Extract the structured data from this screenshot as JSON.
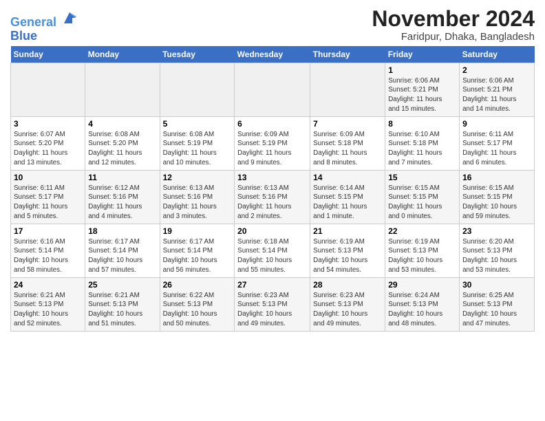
{
  "header": {
    "logo_line1": "General",
    "logo_line2": "Blue",
    "month": "November 2024",
    "location": "Faridpur, Dhaka, Bangladesh"
  },
  "weekdays": [
    "Sunday",
    "Monday",
    "Tuesday",
    "Wednesday",
    "Thursday",
    "Friday",
    "Saturday"
  ],
  "weeks": [
    [
      {
        "day": "",
        "info": ""
      },
      {
        "day": "",
        "info": ""
      },
      {
        "day": "",
        "info": ""
      },
      {
        "day": "",
        "info": ""
      },
      {
        "day": "",
        "info": ""
      },
      {
        "day": "1",
        "info": "Sunrise: 6:06 AM\nSunset: 5:21 PM\nDaylight: 11 hours\nand 15 minutes."
      },
      {
        "day": "2",
        "info": "Sunrise: 6:06 AM\nSunset: 5:21 PM\nDaylight: 11 hours\nand 14 minutes."
      }
    ],
    [
      {
        "day": "3",
        "info": "Sunrise: 6:07 AM\nSunset: 5:20 PM\nDaylight: 11 hours\nand 13 minutes."
      },
      {
        "day": "4",
        "info": "Sunrise: 6:08 AM\nSunset: 5:20 PM\nDaylight: 11 hours\nand 12 minutes."
      },
      {
        "day": "5",
        "info": "Sunrise: 6:08 AM\nSunset: 5:19 PM\nDaylight: 11 hours\nand 10 minutes."
      },
      {
        "day": "6",
        "info": "Sunrise: 6:09 AM\nSunset: 5:19 PM\nDaylight: 11 hours\nand 9 minutes."
      },
      {
        "day": "7",
        "info": "Sunrise: 6:09 AM\nSunset: 5:18 PM\nDaylight: 11 hours\nand 8 minutes."
      },
      {
        "day": "8",
        "info": "Sunrise: 6:10 AM\nSunset: 5:18 PM\nDaylight: 11 hours\nand 7 minutes."
      },
      {
        "day": "9",
        "info": "Sunrise: 6:11 AM\nSunset: 5:17 PM\nDaylight: 11 hours\nand 6 minutes."
      }
    ],
    [
      {
        "day": "10",
        "info": "Sunrise: 6:11 AM\nSunset: 5:17 PM\nDaylight: 11 hours\nand 5 minutes."
      },
      {
        "day": "11",
        "info": "Sunrise: 6:12 AM\nSunset: 5:16 PM\nDaylight: 11 hours\nand 4 minutes."
      },
      {
        "day": "12",
        "info": "Sunrise: 6:13 AM\nSunset: 5:16 PM\nDaylight: 11 hours\nand 3 minutes."
      },
      {
        "day": "13",
        "info": "Sunrise: 6:13 AM\nSunset: 5:16 PM\nDaylight: 11 hours\nand 2 minutes."
      },
      {
        "day": "14",
        "info": "Sunrise: 6:14 AM\nSunset: 5:15 PM\nDaylight: 11 hours\nand 1 minute."
      },
      {
        "day": "15",
        "info": "Sunrise: 6:15 AM\nSunset: 5:15 PM\nDaylight: 11 hours\nand 0 minutes."
      },
      {
        "day": "16",
        "info": "Sunrise: 6:15 AM\nSunset: 5:15 PM\nDaylight: 10 hours\nand 59 minutes."
      }
    ],
    [
      {
        "day": "17",
        "info": "Sunrise: 6:16 AM\nSunset: 5:14 PM\nDaylight: 10 hours\nand 58 minutes."
      },
      {
        "day": "18",
        "info": "Sunrise: 6:17 AM\nSunset: 5:14 PM\nDaylight: 10 hours\nand 57 minutes."
      },
      {
        "day": "19",
        "info": "Sunrise: 6:17 AM\nSunset: 5:14 PM\nDaylight: 10 hours\nand 56 minutes."
      },
      {
        "day": "20",
        "info": "Sunrise: 6:18 AM\nSunset: 5:14 PM\nDaylight: 10 hours\nand 55 minutes."
      },
      {
        "day": "21",
        "info": "Sunrise: 6:19 AM\nSunset: 5:13 PM\nDaylight: 10 hours\nand 54 minutes."
      },
      {
        "day": "22",
        "info": "Sunrise: 6:19 AM\nSunset: 5:13 PM\nDaylight: 10 hours\nand 53 minutes."
      },
      {
        "day": "23",
        "info": "Sunrise: 6:20 AM\nSunset: 5:13 PM\nDaylight: 10 hours\nand 53 minutes."
      }
    ],
    [
      {
        "day": "24",
        "info": "Sunrise: 6:21 AM\nSunset: 5:13 PM\nDaylight: 10 hours\nand 52 minutes."
      },
      {
        "day": "25",
        "info": "Sunrise: 6:21 AM\nSunset: 5:13 PM\nDaylight: 10 hours\nand 51 minutes."
      },
      {
        "day": "26",
        "info": "Sunrise: 6:22 AM\nSunset: 5:13 PM\nDaylight: 10 hours\nand 50 minutes."
      },
      {
        "day": "27",
        "info": "Sunrise: 6:23 AM\nSunset: 5:13 PM\nDaylight: 10 hours\nand 49 minutes."
      },
      {
        "day": "28",
        "info": "Sunrise: 6:23 AM\nSunset: 5:13 PM\nDaylight: 10 hours\nand 49 minutes."
      },
      {
        "day": "29",
        "info": "Sunrise: 6:24 AM\nSunset: 5:13 PM\nDaylight: 10 hours\nand 48 minutes."
      },
      {
        "day": "30",
        "info": "Sunrise: 6:25 AM\nSunset: 5:13 PM\nDaylight: 10 hours\nand 47 minutes."
      }
    ]
  ]
}
